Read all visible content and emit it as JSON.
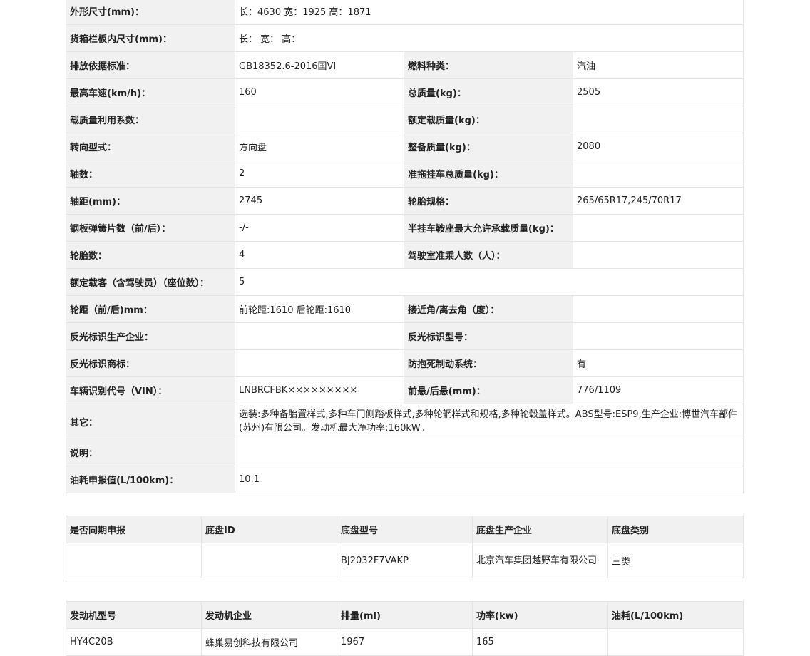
{
  "spec": [
    {
      "l1": "外形尺寸(mm)：",
      "v1": "长：4630 宽：1925 高：1871"
    },
    {
      "l1": "货箱栏板内尺寸(mm)：",
      "v1": "长： 宽： 高："
    },
    {
      "l1": "排放依据标准：",
      "v1": "GB18352.6-2016国VI",
      "l2": "燃料种类：",
      "v2": "汽油"
    },
    {
      "l1": "最高车速(km/h)：",
      "v1": "160",
      "l2": "总质量(kg)：",
      "v2": "2505"
    },
    {
      "l1": "载质量利用系数：",
      "v1": "",
      "l2": "额定载质量(kg)：",
      "v2": ""
    },
    {
      "l1": "转向型式：",
      "v1": "方向盘",
      "l2": "整备质量(kg)：",
      "v2": "2080"
    },
    {
      "l1": "轴数：",
      "v1": "2",
      "l2": "准拖挂车总质量(kg)：",
      "v2": ""
    },
    {
      "l1": "轴距(mm)：",
      "v1": "2745",
      "l2": "轮胎规格：",
      "v2": "265/65R17,245/70R17"
    },
    {
      "l1": "钢板弹簧片数（前/后）：",
      "v1": "-/-",
      "l2": "半挂车鞍座最大允许承载质量(kg)：",
      "v2": ""
    },
    {
      "l1": "轮胎数：",
      "v1": "4",
      "l2": "驾驶室准乘人数（人）：",
      "v2": ""
    },
    {
      "l1": "额定载客（含驾驶员）（座位数）：",
      "v1": "5"
    },
    {
      "l1": "轮距（前/后)mm：",
      "v1": "前轮距:1610 后轮距:1610",
      "l2": "接近角/离去角（度）：",
      "v2": ""
    },
    {
      "l1": "反光标识生产企业：",
      "v1": "",
      "l2": "反光标识型号：",
      "v2": ""
    },
    {
      "l1": "反光标识商标：",
      "v1": "",
      "l2": "防抱死制动系统：",
      "v2": "有"
    },
    {
      "l1": "车辆识别代号（VIN）：",
      "v1": "LNBRCFBK×××××××××",
      "l2": "前悬/后悬(mm)：",
      "v2": "776/1109"
    },
    {
      "l1": "其它：",
      "v1": "选装:多种备胎置样式,多种车门侧踏板样式,多种轮辋样式和规格,多种轮毂盖样式。ABS型号:ESP9,生产企业:博世汽车部件(苏州)有限公司。发动机最大净功率:160kW。"
    },
    {
      "l1": "说明：",
      "v1": ""
    },
    {
      "l1": "油耗申报值(L/100km)：",
      "v1": "10.1"
    }
  ],
  "chassis": {
    "headers": [
      "是否同期申报",
      "底盘ID",
      "底盘型号",
      "底盘生产企业",
      "底盘类别"
    ],
    "row": [
      "",
      "",
      "BJ2032F7VAKP",
      "北京汽车集团越野车有限公司",
      "三类"
    ]
  },
  "engine": {
    "headers": [
      "发动机型号",
      "发动机企业",
      "排量(ml)",
      "功率(kw)",
      "油耗(L/100km)"
    ],
    "row": [
      "HY4C20B",
      "蜂巢易创科技有限公司",
      "1967",
      "165",
      ""
    ]
  }
}
